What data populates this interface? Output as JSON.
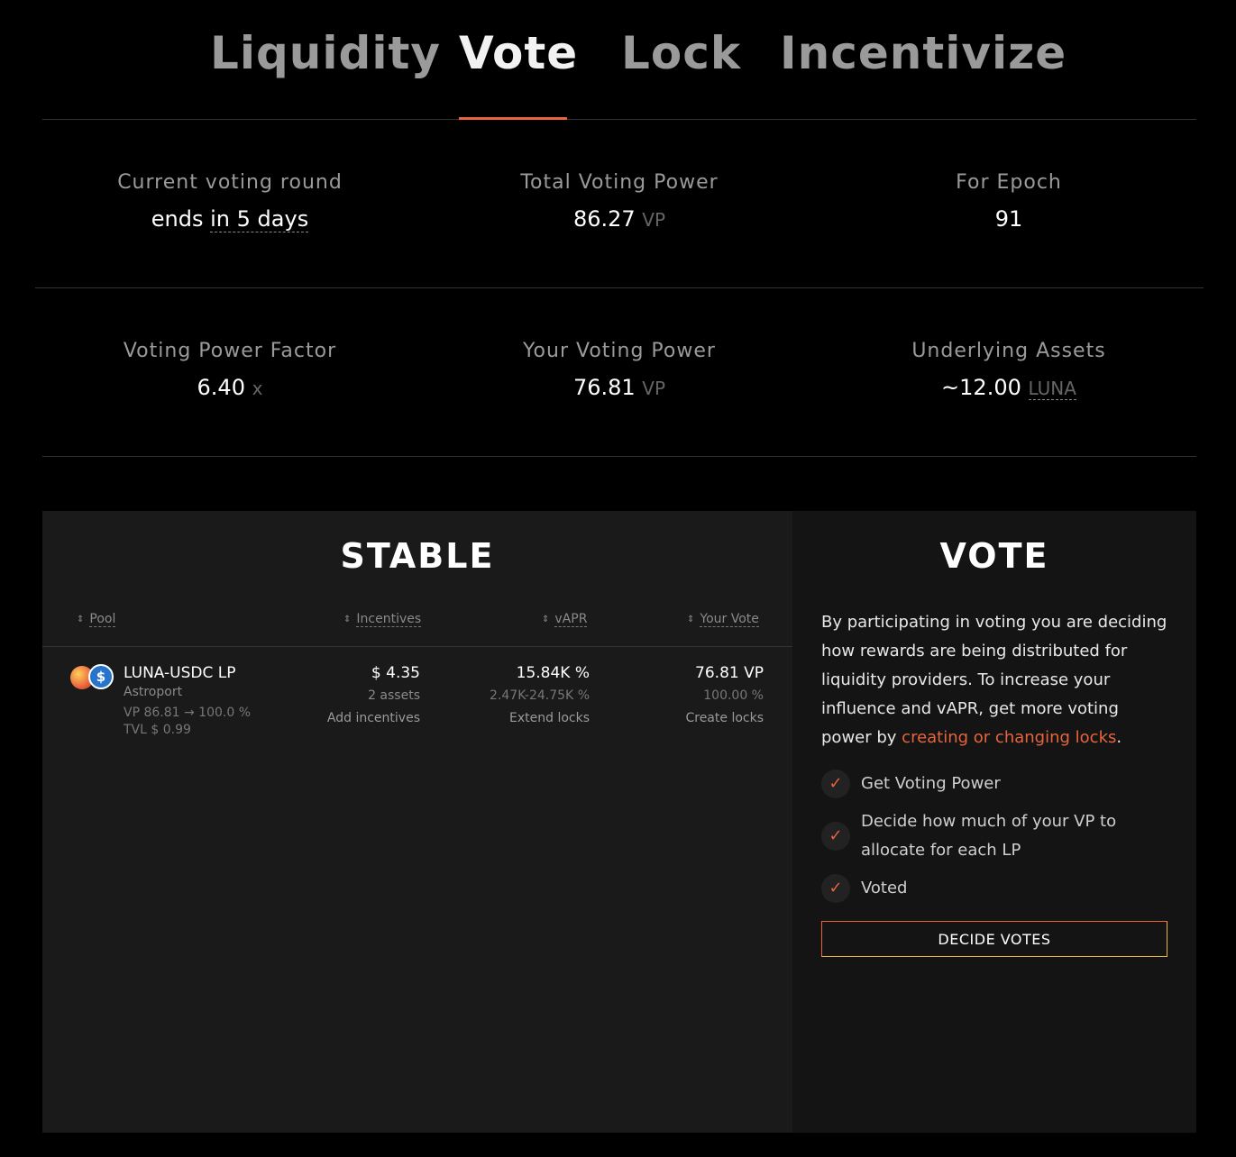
{
  "tabs": [
    {
      "label": "Liquidity",
      "active": false
    },
    {
      "label": "Vote",
      "active": true
    },
    {
      "label": "Lock",
      "active": false
    },
    {
      "label": "Incentivize",
      "active": false
    }
  ],
  "accent_color": "#e8643c",
  "stats": {
    "current_round": {
      "label": "Current voting round",
      "prefix": "ends",
      "value": "in 5 days"
    },
    "total_vp": {
      "label": "Total Voting Power",
      "value": "86.27",
      "unit": "VP"
    },
    "epoch": {
      "label": "For Epoch",
      "value": "91"
    },
    "vp_factor": {
      "label": "Voting Power Factor",
      "value": "6.40",
      "unit": "x"
    },
    "your_vp": {
      "label": "Your Voting Power",
      "value": "76.81",
      "unit": "VP"
    },
    "underlying": {
      "label": "Underlying Assets",
      "value": "~12.00",
      "unit": "LUNA"
    }
  },
  "stable": {
    "title": "STABLE",
    "columns": {
      "pool": "Pool",
      "incentives": "Incentives",
      "vapr": "vAPR",
      "your_vote": "Your Vote"
    },
    "rows": [
      {
        "icons": [
          "luna-icon",
          "usdc-icon"
        ],
        "name": "LUNA-USDC LP",
        "dex": "Astroport",
        "vp_line": "VP 86.81 → 100.0 %",
        "tvl_line": "TVL $ 0.99",
        "incentives": "$ 4.35",
        "incentives_sub": "2 assets",
        "incentives_link": "Add incentives",
        "vapr": "15.84K %",
        "vapr_sub": "2.47K-24.75K %",
        "vapr_link": "Extend locks",
        "vote": "76.81 VP",
        "vote_sub": "100.00 %",
        "vote_link": "Create locks"
      }
    ]
  },
  "vote_panel": {
    "title": "VOTE",
    "description": "By participating in voting you are deciding how rewards are being distributed for liquidity providers. To increase your influence and vAPR, get more voting power by",
    "link_text": "creating or changing locks",
    "period": ".",
    "steps": [
      "Get Voting Power",
      "Decide how much of your VP to allocate for each LP",
      "Voted"
    ],
    "button": "DECIDE VOTES"
  }
}
